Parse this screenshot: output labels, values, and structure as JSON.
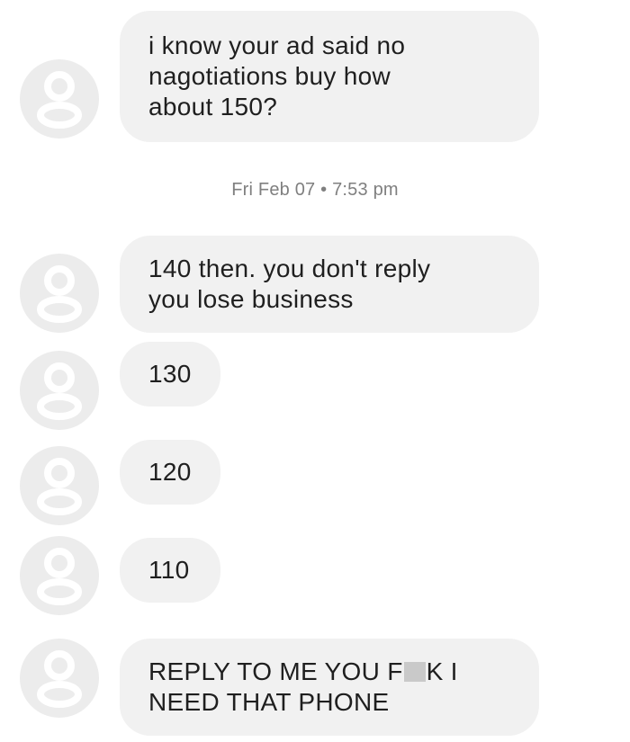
{
  "messages": [
    {
      "text": "i know your ad said no\nnagotiations buy how\nabout 150?"
    },
    {
      "text": "140 then. you don't reply\nyou lose business"
    },
    {
      "text": "130"
    },
    {
      "text": "120"
    },
    {
      "text": "110"
    },
    {
      "line1_pre": "REPLY TO ME YOU F",
      "line1_post": "K I",
      "line2": "NEED THAT PHONE"
    }
  ],
  "timestamp": "Fri Feb 07 • 7:53 pm",
  "colors": {
    "bubble": "#f1f1f1",
    "avatar": "#ececec",
    "avatar_glyph": "#ffffff",
    "timestamp": "#7f7f7f"
  },
  "icons": {
    "avatar": "default-profile-icon"
  }
}
